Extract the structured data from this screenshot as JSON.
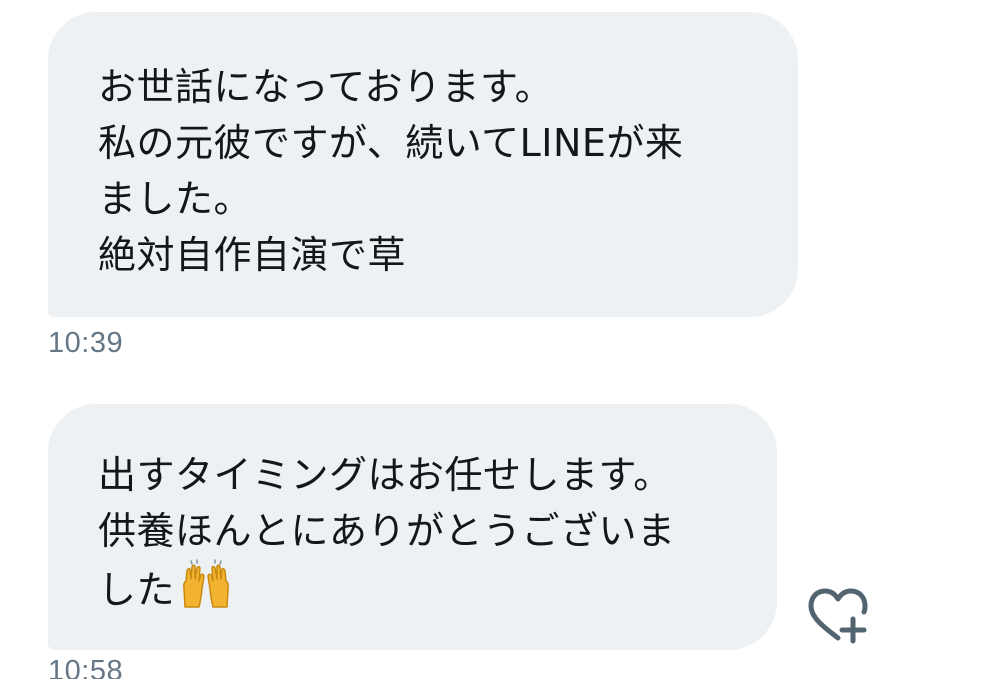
{
  "messages": [
    {
      "lines": [
        "お世話になっております。",
        "私の元彼ですが、続いてLINEが来",
        "ました。",
        "絶対自作自演で草"
      ],
      "time": "10:39"
    },
    {
      "lines": [
        "出すタイミングはお任せします。",
        "供養ほんとにありがとうございま",
        "した"
      ],
      "emoji": "raising-hands-emoji",
      "time": "10:58"
    }
  ],
  "reaction": {
    "icon": "heart-plus-icon"
  },
  "colors": {
    "bubble": "#eef1f3",
    "text": "#14171a",
    "timestamp": "#657786",
    "icon": "#536471"
  }
}
